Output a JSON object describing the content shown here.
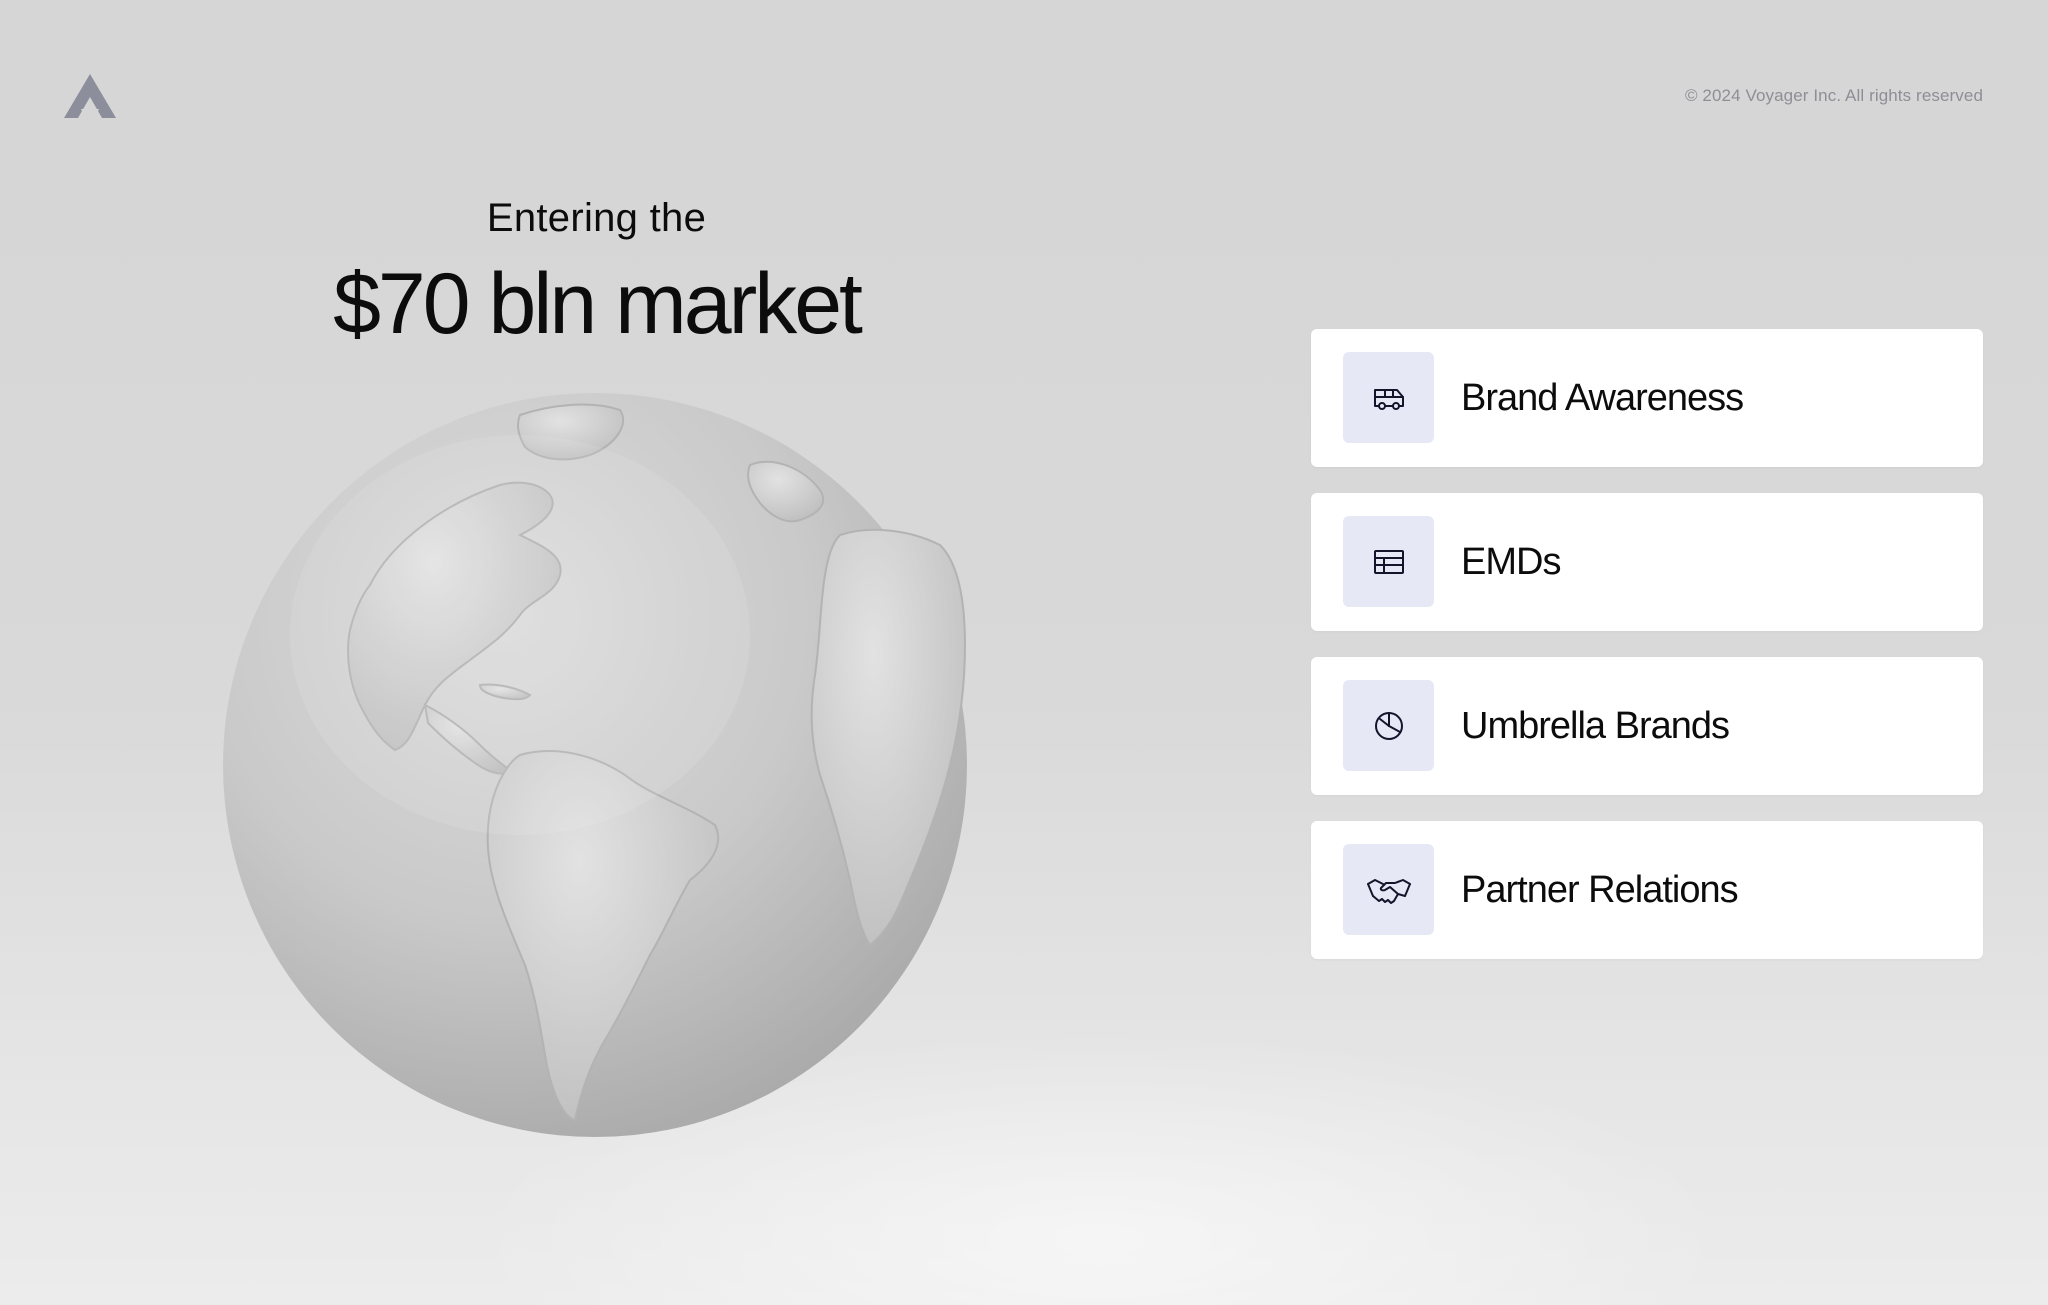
{
  "header": {
    "logo": "voyager-logo",
    "copyright": "© 2024 Voyager Inc. All rights reserved"
  },
  "headline": {
    "subtitle": "Entering the",
    "title": "$70 bln market"
  },
  "cards": [
    {
      "label": "Brand Awareness",
      "icon": "van-icon"
    },
    {
      "label": "EMDs",
      "icon": "table-icon"
    },
    {
      "label": "Umbrella Brands",
      "icon": "pie-chart-icon"
    },
    {
      "label": "Partner Relations",
      "icon": "handshake-icon"
    }
  ],
  "colors": {
    "background": "#d7d7d7",
    "icon_box": "#e7e8f5",
    "text": "#0c0c0c",
    "muted_text": "#8e8e96",
    "logo": "#8c8f9b"
  }
}
